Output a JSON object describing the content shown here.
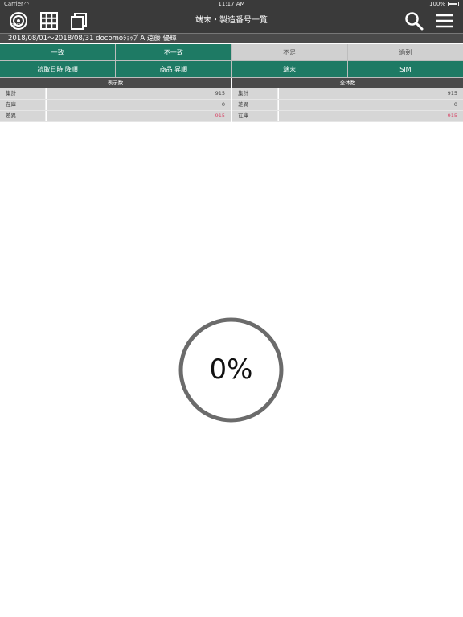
{
  "status_bar": {
    "carrier": "Carrier",
    "time": "11:17 AM",
    "battery": "100%"
  },
  "nav": {
    "title": "端末・製造番号一覧",
    "rfid_label": "RFID"
  },
  "info_bar": {
    "text": "2018/08/01～2018/08/31  docomoｼｮｯﾌﾟA  遠藤 優輝"
  },
  "filter_tabs": [
    {
      "label": "一致",
      "active": true
    },
    {
      "label": "不一致",
      "active": true
    },
    {
      "label": "不足",
      "active": false
    },
    {
      "label": "過剰",
      "active": false
    }
  ],
  "sort_tabs": [
    {
      "label": "読取日時 降順",
      "active": true
    },
    {
      "label": "商品 昇順",
      "active": true
    },
    {
      "label": "端末",
      "active": true
    },
    {
      "label": "SIM",
      "active": true
    }
  ],
  "display_counts": {
    "header": "表示数",
    "rows": [
      {
        "label": "集計",
        "value": "915"
      },
      {
        "label": "在庫",
        "value": "0"
      },
      {
        "label": "差異",
        "value": "-915"
      }
    ]
  },
  "total_counts": {
    "header": "全体数",
    "rows": [
      {
        "label": "集計",
        "value": "915"
      },
      {
        "label": "差異",
        "value": "0"
      },
      {
        "label": "在庫",
        "value": "-915"
      }
    ]
  },
  "progress": {
    "text": "0%",
    "value": 0
  },
  "colors": {
    "active_tab": "#1e7a64",
    "inactive_tab": "#d0d0d0",
    "header_bg": "#3a3a3a",
    "negative_value": "#d84a6a",
    "progress_ring": "#6b6b6b"
  }
}
